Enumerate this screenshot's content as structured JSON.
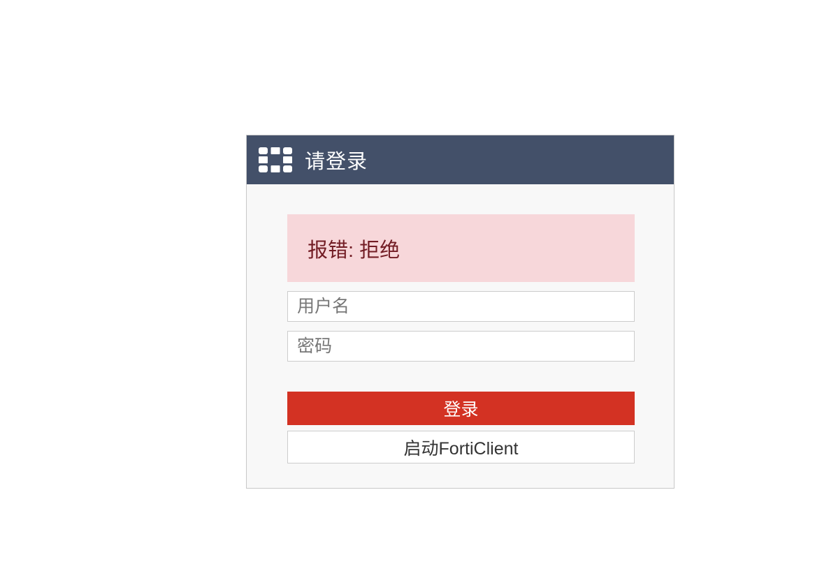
{
  "header": {
    "title": "请登录",
    "logo_icon": "fortinet-logo-icon"
  },
  "error": {
    "message": "报错: 拒绝"
  },
  "form": {
    "username_placeholder": "用户名",
    "username_value": "",
    "password_placeholder": "密码",
    "password_value": "",
    "login_label": "登录",
    "forticlient_label": "启动FortiClient"
  },
  "colors": {
    "header_bg": "#435069",
    "error_bg": "#f7d7da",
    "error_text": "#721c24",
    "login_button_bg": "#d33223"
  }
}
